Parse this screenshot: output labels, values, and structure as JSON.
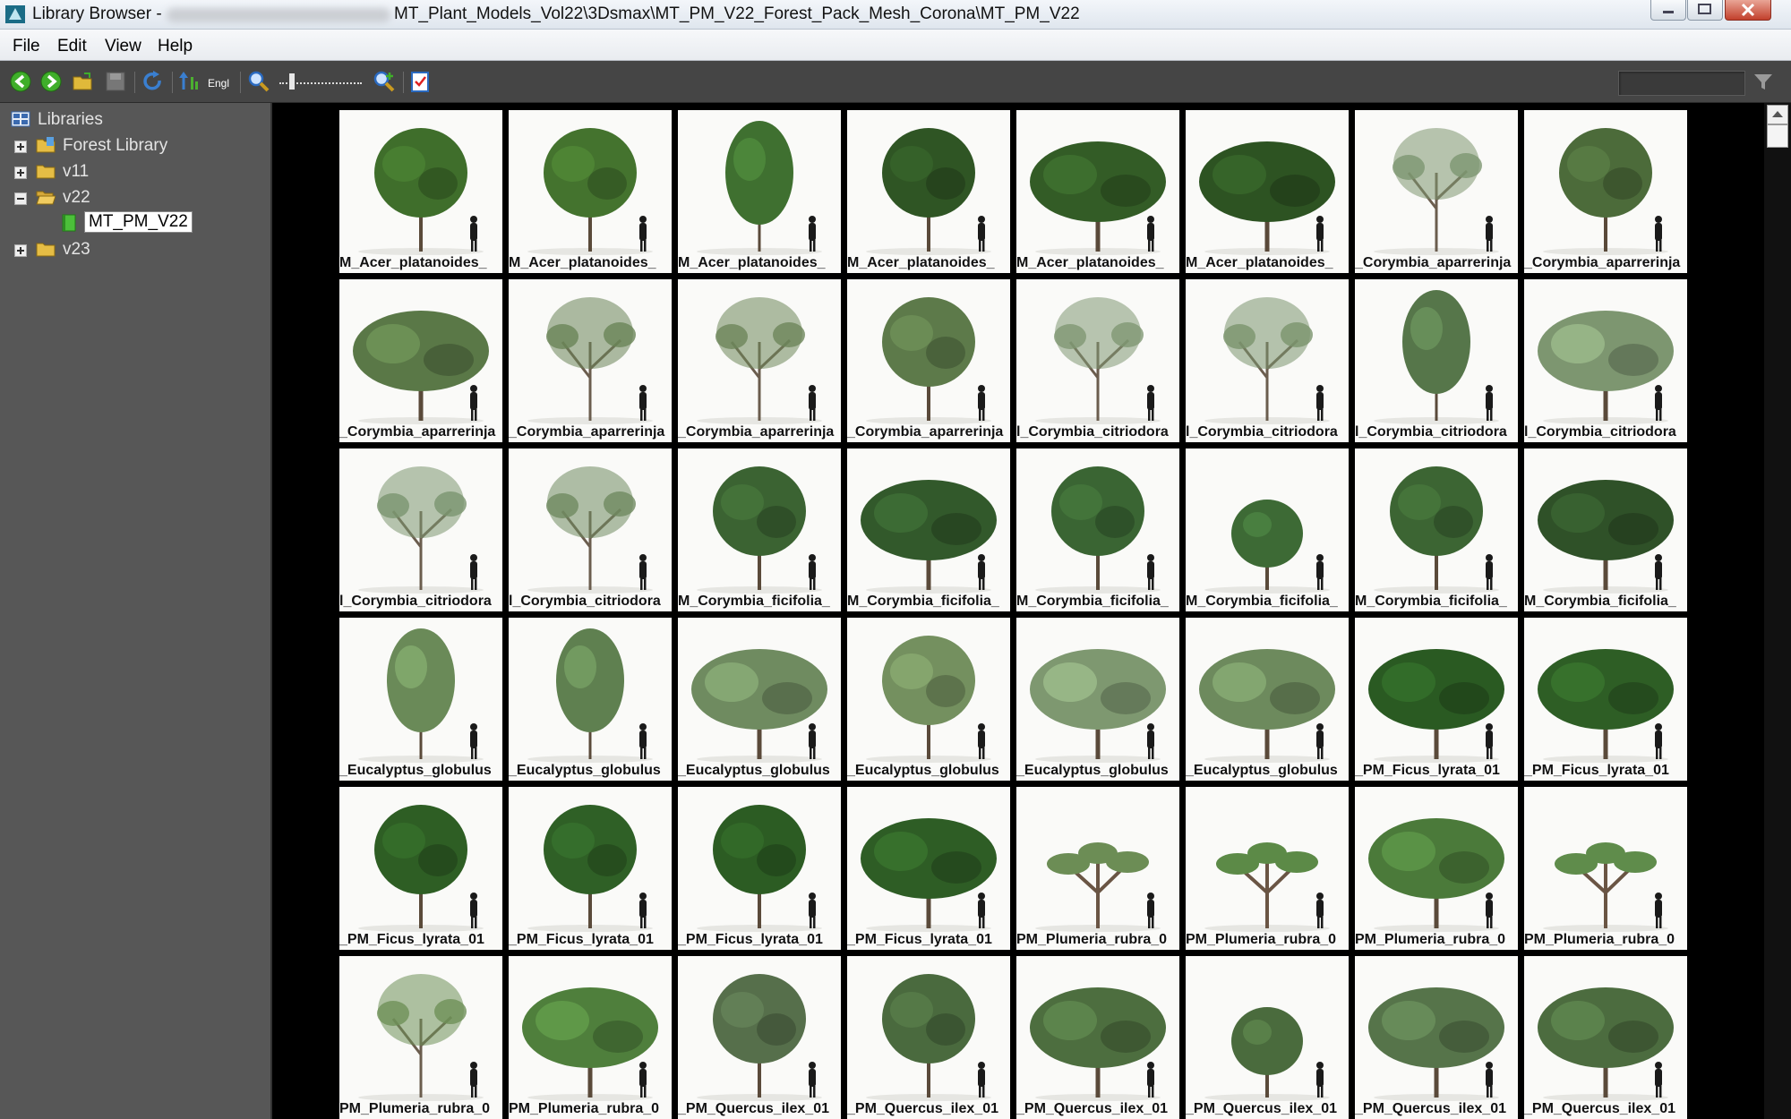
{
  "window": {
    "title_prefix": "Library Browser -",
    "title_path": "MT_Plant_Models_Vol22\\3Dsmax\\MT_PM_V22_Forest_Pack_Mesh_Corona\\MT_PM_V22"
  },
  "menu": [
    "File",
    "Edit",
    "View",
    "Help"
  ],
  "toolbar": {
    "icons": [
      "back-icon",
      "forward-icon",
      "open-folder-icon",
      "save-icon",
      "refresh-icon",
      "sort-icon",
      "language-icon",
      "zoom-out-icon",
      "zoom-in-icon",
      "checklist-icon",
      "filter-icon"
    ],
    "english_label": "Engl"
  },
  "tree": {
    "root": "Libraries",
    "items": [
      {
        "label": "Forest Library",
        "expanded": false
      },
      {
        "label": "v11",
        "expanded": false
      },
      {
        "label": "v22",
        "expanded": true
      },
      {
        "label": "MT_PM_V22",
        "selected": true
      },
      {
        "label": "v23",
        "expanded": false
      }
    ]
  },
  "thumbnails": [
    {
      "label": "M_Acer_platanoides_",
      "foliage": "#3f6e2b",
      "shape": "round"
    },
    {
      "label": "M_Acer_platanoides_",
      "foliage": "#44732e",
      "shape": "round"
    },
    {
      "label": "M_Acer_platanoides_",
      "foliage": "#3f7030",
      "shape": "tall"
    },
    {
      "label": "M_Acer_platanoides_",
      "foliage": "#2f5524",
      "shape": "round"
    },
    {
      "label": "M_Acer_platanoides_",
      "foliage": "#335c26",
      "shape": "wide"
    },
    {
      "label": "M_Acer_platanoides_",
      "foliage": "#2d5322",
      "shape": "wide"
    },
    {
      "label": "_Corymbia_aparrerinja",
      "foliage": "#7d9670",
      "shape": "sparse"
    },
    {
      "label": "_Corymbia_aparrerinja",
      "foliage": "#4c6b3a",
      "shape": "round"
    },
    {
      "label": "_Corymbia_aparrerinja",
      "foliage": "#5a7847",
      "shape": "wide"
    },
    {
      "label": "_Corymbia_aparrerinja",
      "foliage": "#6a8458",
      "shape": "sparse"
    },
    {
      "label": "_Corymbia_aparrerinja",
      "foliage": "#6d865a",
      "shape": "sparse"
    },
    {
      "label": "_Corymbia_aparrerinja",
      "foliage": "#5d7a4a",
      "shape": "round"
    },
    {
      "label": "l_Corymbia_citriodora",
      "foliage": "#7f9773",
      "shape": "sparse"
    },
    {
      "label": "l_Corymbia_citriodora",
      "foliage": "#7a946d",
      "shape": "sparse"
    },
    {
      "label": "l_Corymbia_citriodora",
      "foliage": "#56764a",
      "shape": "tall"
    },
    {
      "label": "l_Corymbia_citriodora",
      "foliage": "#7d9670",
      "shape": "wide"
    },
    {
      "label": "l_Corymbia_citriodora",
      "foliage": "#7b956f",
      "shape": "sparse"
    },
    {
      "label": "l_Corymbia_citriodora",
      "foliage": "#6f8a60",
      "shape": "sparse"
    },
    {
      "label": "M_Corymbia_ficifolia_",
      "foliage": "#3b6332",
      "shape": "round"
    },
    {
      "label": "M_Corymbia_ficifolia_",
      "foliage": "#32592b",
      "shape": "wide"
    },
    {
      "label": "M_Corymbia_ficifolia_",
      "foliage": "#3a6533",
      "shape": "round"
    },
    {
      "label": "M_Corymbia_ficifolia_",
      "foliage": "#3d6a35",
      "shape": "small"
    },
    {
      "label": "M_Corymbia_ficifolia_",
      "foliage": "#3c6533",
      "shape": "round"
    },
    {
      "label": "M_Corymbia_ficifolia_",
      "foliage": "#2f5128",
      "shape": "wide"
    },
    {
      "label": "_Eucalyptus_globulus",
      "foliage": "#6a8a58",
      "shape": "tall"
    },
    {
      "label": "_Eucalyptus_globulus",
      "foliage": "#5f8050",
      "shape": "tall"
    },
    {
      "label": "_Eucalyptus_globulus",
      "foliage": "#6f8b60",
      "shape": "wide"
    },
    {
      "label": "_Eucalyptus_globulus",
      "foliage": "#74905f",
      "shape": "round"
    },
    {
      "label": "_Eucalyptus_globulus",
      "foliage": "#7e9870",
      "shape": "wide"
    },
    {
      "label": "_Eucalyptus_globulus",
      "foliage": "#6d8a5d",
      "shape": "wide"
    },
    {
      "label": "_PM_Ficus_lyrata_01",
      "foliage": "#2a5a22",
      "shape": "wide"
    },
    {
      "label": "_PM_Ficus_lyrata_01",
      "foliage": "#2e5e25",
      "shape": "wide"
    },
    {
      "label": "_PM_Ficus_lyrata_01",
      "foliage": "#2e5e24",
      "shape": "round"
    },
    {
      "label": "_PM_Ficus_lyrata_01",
      "foliage": "#2f6026",
      "shape": "round"
    },
    {
      "label": "_PM_Ficus_lyrata_01",
      "foliage": "#2c5c23",
      "shape": "round"
    },
    {
      "label": "_PM_Ficus_lyrata_01",
      "foliage": "#2e5d25",
      "shape": "wide"
    },
    {
      "label": "PM_Plumeria_rubra_0",
      "foliage": "#6c8d55",
      "shape": "plumeria"
    },
    {
      "label": "PM_Plumeria_rubra_0",
      "foliage": "#5c8a47",
      "shape": "plumeria"
    },
    {
      "label": "PM_Plumeria_rubra_0",
      "foliage": "#4b7a3a",
      "shape": "wide"
    },
    {
      "label": "PM_Plumeria_rubra_0",
      "foliage": "#5f8c4b",
      "shape": "plumeria"
    },
    {
      "label": "PM_Plumeria_rubra_0",
      "foliage": "#6e9058",
      "shape": "sparse"
    },
    {
      "label": "PM_Plumeria_rubra_0",
      "foliage": "#4f7f3c",
      "shape": "wide"
    },
    {
      "label": "_PM_Quercus_ilex_01",
      "foliage": "#566f4b",
      "shape": "round"
    },
    {
      "label": "_PM_Quercus_ilex_01",
      "foliage": "#4a6a3e",
      "shape": "round"
    },
    {
      "label": "_PM_Quercus_ilex_01",
      "foliage": "#4d6e3f",
      "shape": "wide"
    },
    {
      "label": "_PM_Quercus_ilex_01",
      "foliage": "#4a6b3d",
      "shape": "small"
    },
    {
      "label": "_PM_Quercus_ilex_01",
      "foliage": "#56744a",
      "shape": "wide"
    },
    {
      "label": "_PM_Quercus_ilex_01",
      "foliage": "#4c6c3f",
      "shape": "wide"
    }
  ]
}
